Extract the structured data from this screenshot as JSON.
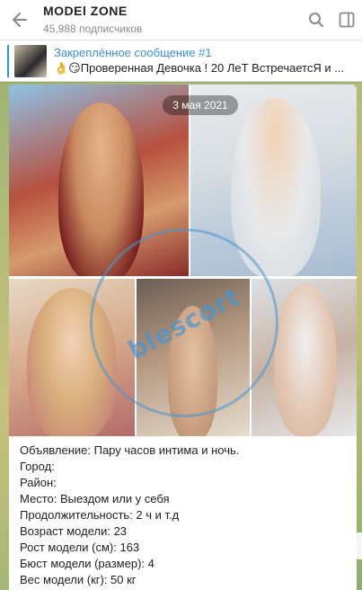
{
  "header": {
    "title": "MODEl ZONE",
    "subtitle": "45,988 подписчиков"
  },
  "pinned": {
    "title": "Закреплённое сообщение #1",
    "body": "👌😏Проверенная Девочка ! 20 ЛеТ ВстречаетсЯ и ..."
  },
  "message": {
    "date": "3 мая 2021",
    "watermark": "blescort",
    "lines": [
      "Объявление: Пару часов интима и ночь.",
      "Город:",
      "Район:",
      "Место: Выездом или у себя",
      "Продолжительность: 2 ч и т.д",
      "Возраст модели: 23",
      "Рост модели (см): 163",
      "Бюст модели (размер): 4",
      "Вес модели (кг): 50 кг"
    ]
  },
  "colors": {
    "accent": "#3a8fd1",
    "chat_bg": "#9fb574"
  },
  "icons": [
    "back-arrow-icon",
    "search-icon",
    "sidebar-toggle-icon"
  ]
}
